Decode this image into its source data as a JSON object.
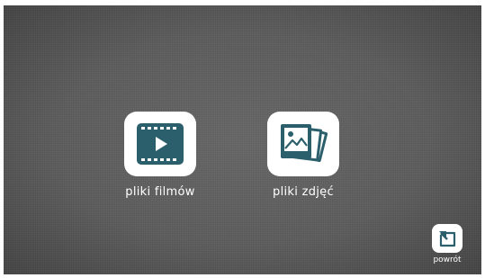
{
  "theme": {
    "accent": "#2b5f6b",
    "tile_bg": "#ffffff",
    "screen_bg": "#5b5b5b",
    "label_color": "#ffffff"
  },
  "tiles": [
    {
      "label": "pliki filmów",
      "icon": "film-icon"
    },
    {
      "label": "pliki zdjęć",
      "icon": "photos-icon"
    }
  ],
  "back": {
    "label": "powrót",
    "icon": "back-arrow-icon"
  }
}
